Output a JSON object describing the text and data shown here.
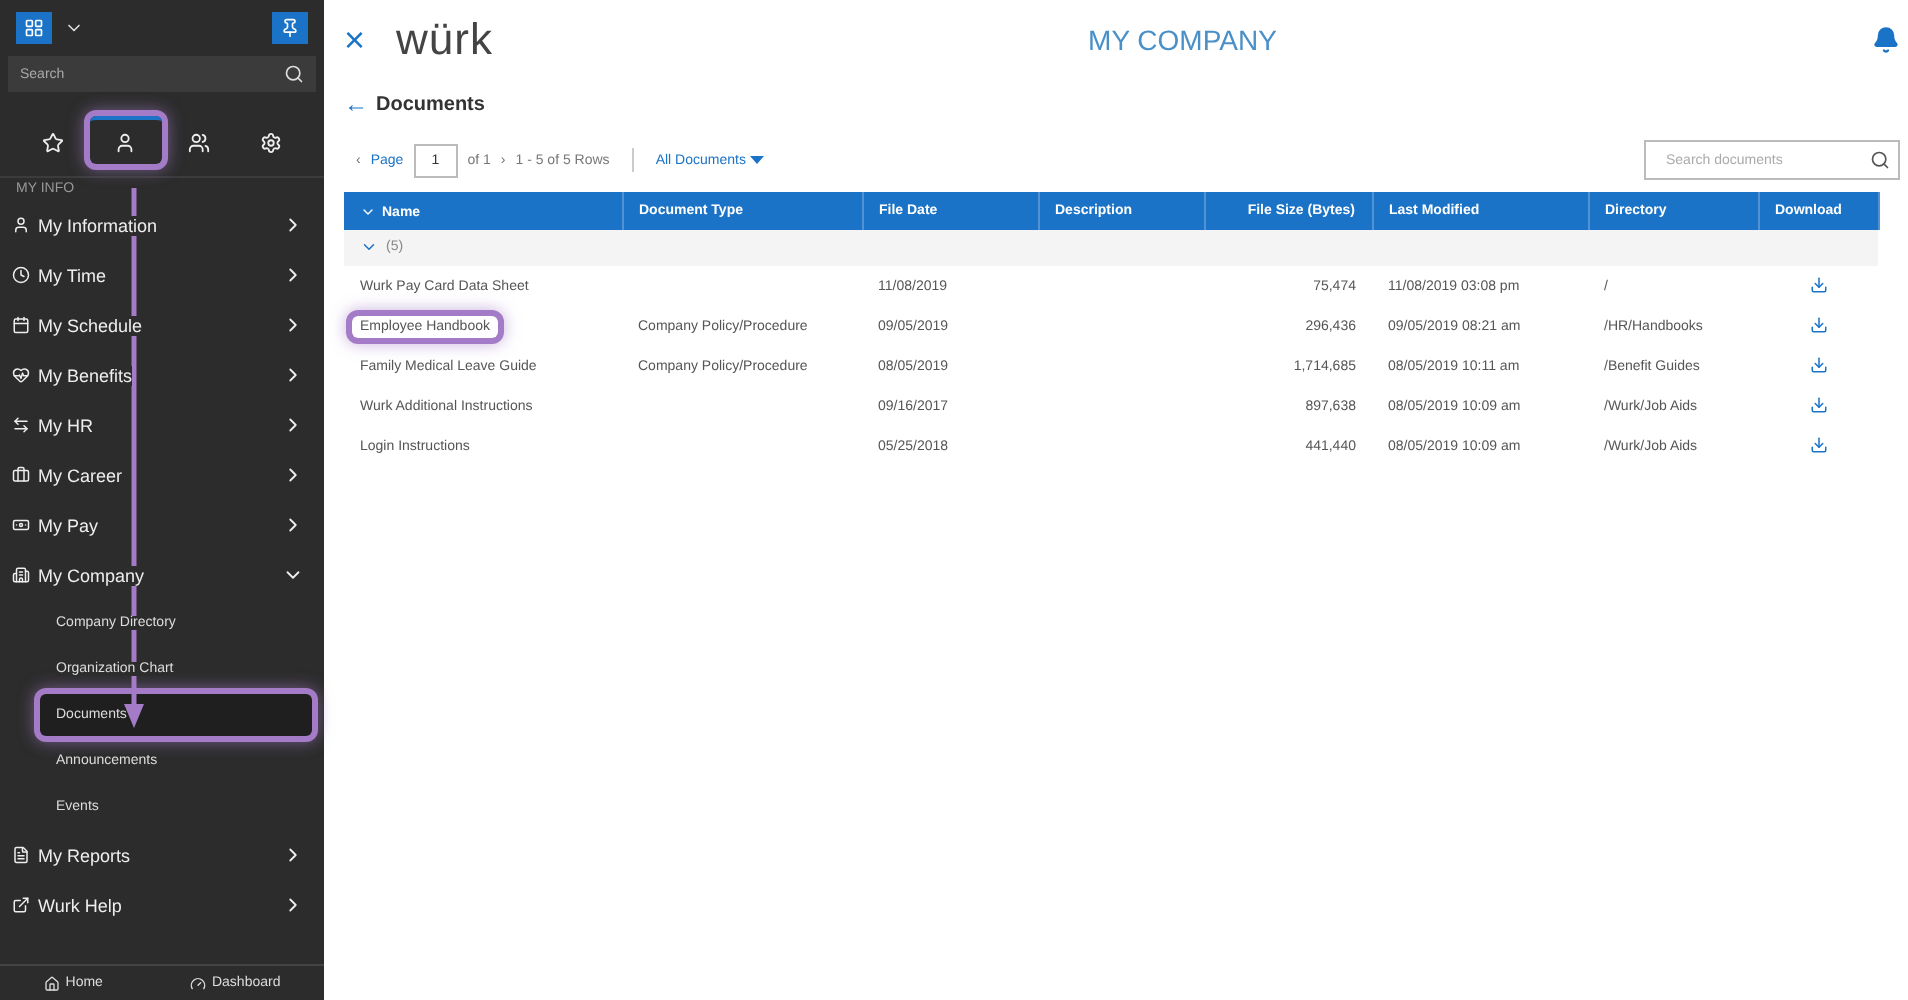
{
  "sidebar": {
    "search": {
      "placeholder": "Search"
    },
    "tabs": [
      {
        "selected": false,
        "highlighted": false
      },
      {
        "selected": true,
        "highlighted": true
      },
      {
        "selected": false,
        "highlighted": false
      },
      {
        "selected": false,
        "highlighted": false
      }
    ],
    "section": "MY INFO",
    "items": [
      {
        "label": "My Information",
        "expanded": false
      },
      {
        "label": "My Time",
        "expanded": false
      },
      {
        "label": "My Schedule",
        "expanded": false
      },
      {
        "label": "My Benefits",
        "expanded": false
      },
      {
        "label": "My HR",
        "expanded": false
      },
      {
        "label": "My Career",
        "expanded": false
      },
      {
        "label": "My Pay",
        "expanded": false
      },
      {
        "label": "My Company",
        "expanded": true,
        "children": [
          {
            "label": "Company Directory",
            "selected": false,
            "highlighted": false
          },
          {
            "label": "Organization Chart",
            "selected": false,
            "highlighted": false
          },
          {
            "label": "Documents",
            "selected": true,
            "highlighted": true
          },
          {
            "label": "Announcements",
            "selected": false,
            "highlighted": false
          },
          {
            "label": "Events",
            "selected": false,
            "highlighted": false
          }
        ]
      },
      {
        "label": "My Reports",
        "expanded": false
      },
      {
        "label": "Wurk Help",
        "expanded": false
      }
    ],
    "footer": [
      "Home",
      "Dashboard"
    ]
  },
  "header": {
    "close": "×",
    "logo": "würk",
    "title": "MY COMPANY"
  },
  "page": {
    "back": "←",
    "title": "Documents"
  },
  "pager": {
    "prev": "‹",
    "label": "Page",
    "page": "1",
    "of": "of 1",
    "next": "›",
    "rows": "1 - 5 of 5 Rows",
    "filter": "All Documents"
  },
  "search": {
    "placeholder": "Search documents"
  },
  "table": {
    "columns": [
      "Name",
      "Document Type",
      "File Date",
      "Description",
      "File Size (Bytes)",
      "Last Modified",
      "Directory",
      "Download"
    ],
    "group": "(5)",
    "group_expanded": true,
    "rows": [
      {
        "name": "Wurk Pay Card Data Sheet",
        "type": "",
        "date": "11/08/2019",
        "size": "75,474",
        "modified": "11/08/2019 03:08 pm",
        "directory": "/",
        "highlighted": false
      },
      {
        "name": "Employee Handbook",
        "type": "Company Policy/Procedure",
        "date": "09/05/2019",
        "size": "296,436",
        "modified": "09/05/2019 08:21 am",
        "directory": "/HR/Handbooks",
        "highlighted": true
      },
      {
        "name": "Family Medical Leave Guide",
        "type": "Company Policy/Procedure",
        "date": "08/05/2019",
        "size": "1,714,685",
        "modified": "08/05/2019 10:11 am",
        "directory": "/Benefit Guides",
        "highlighted": false
      },
      {
        "name": "Wurk Additional Instructions",
        "type": "",
        "date": "09/16/2017",
        "size": "897,638",
        "modified": "08/05/2019 10:09 am",
        "directory": "/Wurk/Job Aids",
        "highlighted": false
      },
      {
        "name": "Login Instructions",
        "type": "",
        "date": "05/25/2018",
        "size": "441,440",
        "modified": "08/05/2019 10:09 am",
        "directory": "/Wurk/Job Aids",
        "highlighted": false
      }
    ]
  }
}
